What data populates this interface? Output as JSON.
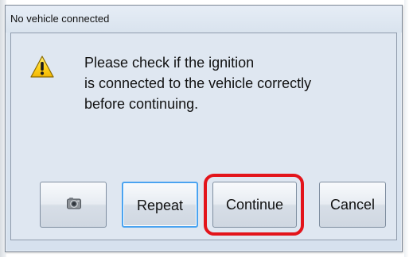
{
  "dialog": {
    "title": "No vehicle connected",
    "message_lines": [
      "Please check if the ignition",
      "is connected to the vehicle correctly",
      "before continuing."
    ]
  },
  "icons": {
    "warning": "warning-icon",
    "camera": "camera-icon"
  },
  "buttons": {
    "camera": "",
    "repeat": "Repeat",
    "continue": "Continue",
    "cancel": "Cancel"
  },
  "colors": {
    "highlight": "#e3141b",
    "focus": "#4aa3f0",
    "dialog_background": "#dfe7f1"
  }
}
